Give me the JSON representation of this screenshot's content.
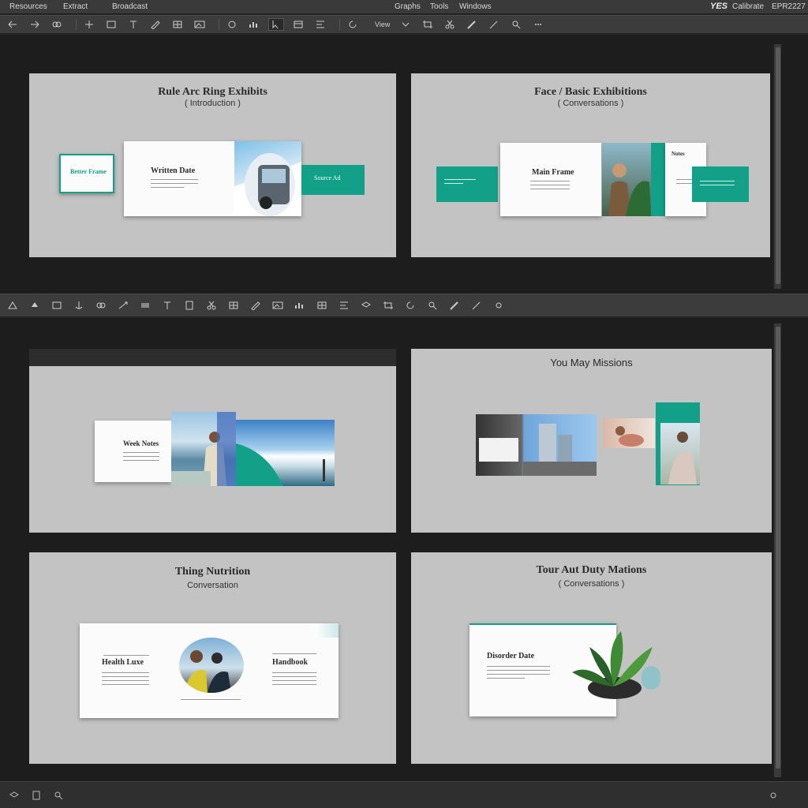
{
  "menubar": {
    "items": [
      "Resources",
      "Extract",
      "Broadcast"
    ],
    "center_items": [
      "Graphs",
      "Tools",
      "Windows"
    ],
    "logo": "YES",
    "right_label": "Calibrate",
    "right_code": "EPR2227"
  },
  "toolbar_top": {
    "view_label": "View"
  },
  "slides": {
    "s1": {
      "title": "Rule Arc Ring Exhibits",
      "subtitle": "( Introduction )",
      "card_title": "Written Date",
      "left_box": "Better Frame",
      "right_box": "Source Ad"
    },
    "s2": {
      "title": "Face / Basic Exhibitions",
      "subtitle": "( Conversations )",
      "card_title": "Main Frame",
      "right_card_title": "Notes"
    },
    "s3": {
      "card_title": "Week Notes"
    },
    "s4": {
      "title": "You May Missions"
    },
    "s5": {
      "title": "Thing Nutrition",
      "subtitle": "Conversation",
      "card_title": "Health Luxe",
      "right_card_title": "Handbook"
    },
    "s6": {
      "title": "Tour Aut Duty Mations",
      "subtitle": "( Conversations )",
      "card_title": "Disorder Date"
    }
  },
  "colors": {
    "accent": "#13a088",
    "slide_bg": "#c3c3c3",
    "ui_bg": "#3c3c3c"
  }
}
